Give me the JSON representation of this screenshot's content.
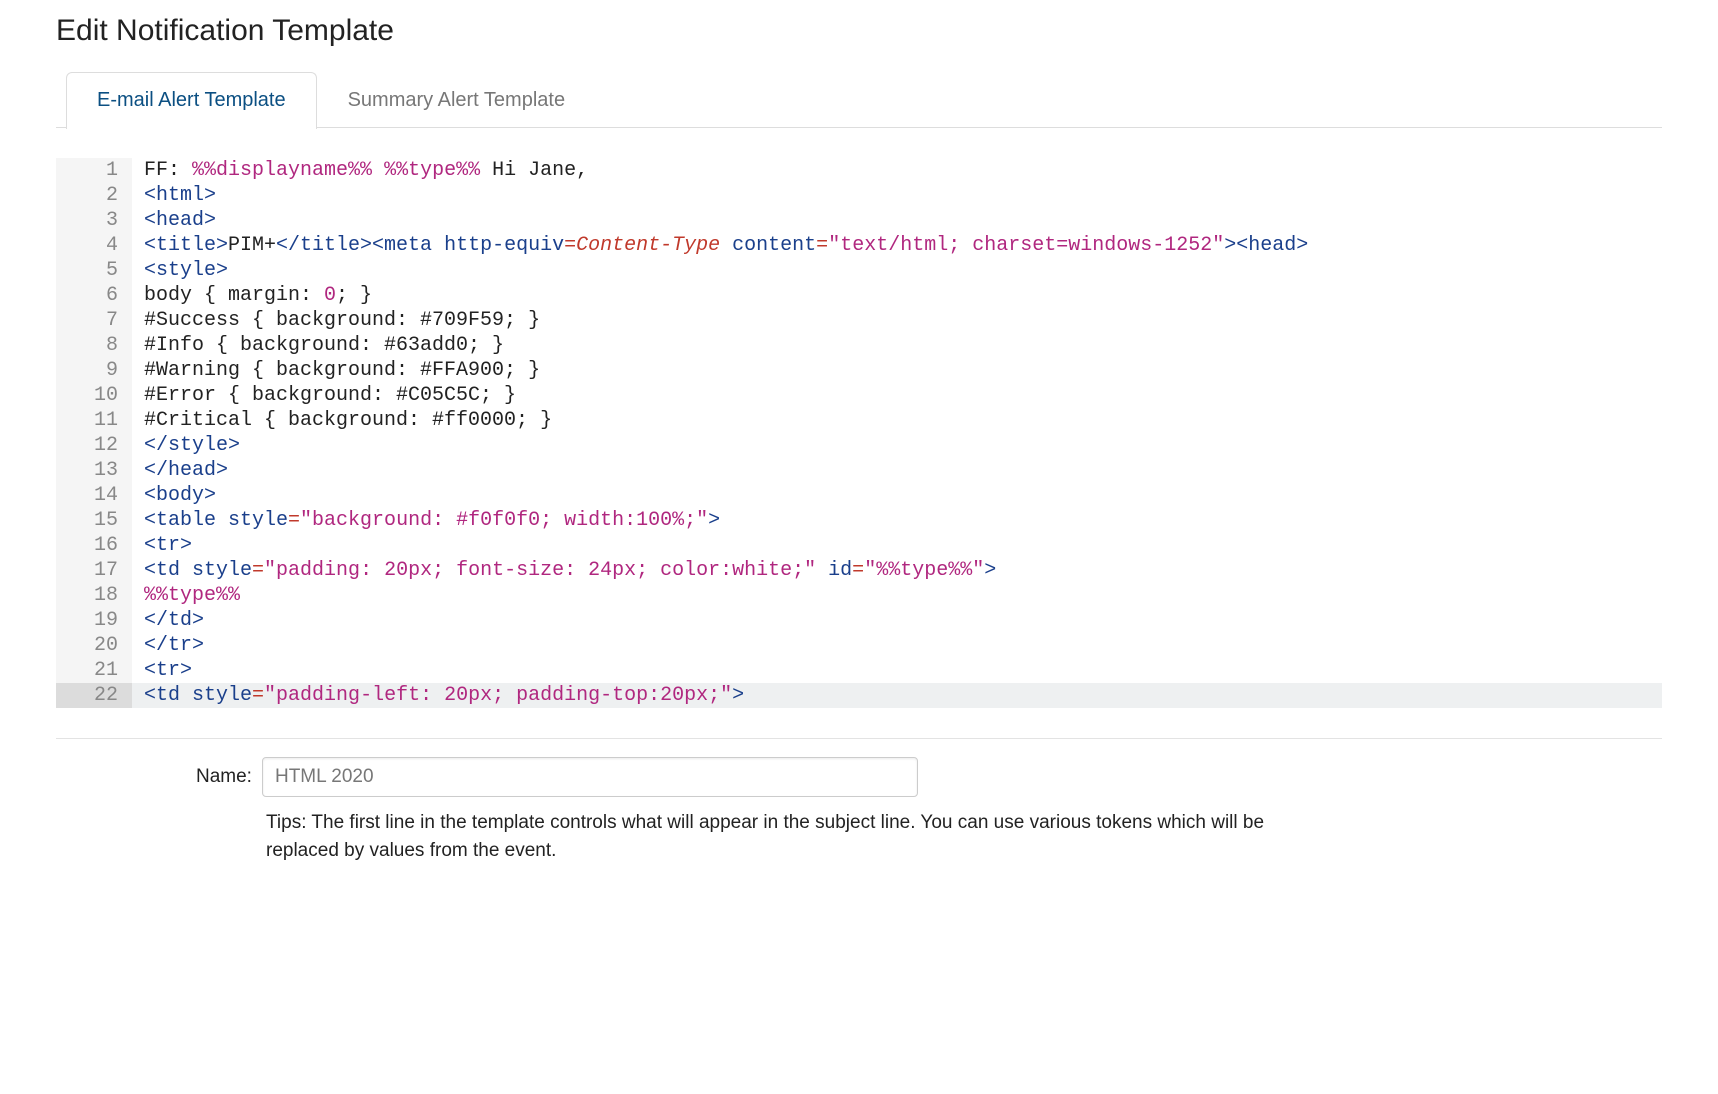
{
  "header": {
    "title": "Edit Notification Template"
  },
  "tabs": [
    {
      "label": "E-mail Alert Template",
      "active": true
    },
    {
      "label": "Summary Alert Template",
      "active": false
    }
  ],
  "editor": {
    "current_line": 22,
    "lines": [
      {
        "n": 1,
        "segments": [
          {
            "t": "FF: ",
            "c": "c-default"
          },
          {
            "t": "%%displayname%%",
            "c": "c-token"
          },
          {
            "t": " ",
            "c": "c-default"
          },
          {
            "t": "%%type%%",
            "c": "c-token"
          },
          {
            "t": " Hi Jane,",
            "c": "c-default"
          }
        ]
      },
      {
        "n": 2,
        "segments": [
          {
            "t": "<html>",
            "c": "c-tag"
          }
        ]
      },
      {
        "n": 3,
        "segments": [
          {
            "t": "<head>",
            "c": "c-tag"
          }
        ]
      },
      {
        "n": 4,
        "segments": [
          {
            "t": "<title>",
            "c": "c-tag"
          },
          {
            "t": "PIM+",
            "c": "c-default"
          },
          {
            "t": "</title>",
            "c": "c-tag"
          },
          {
            "t": "<meta ",
            "c": "c-tag"
          },
          {
            "t": "http-equiv",
            "c": "c-attr"
          },
          {
            "t": "=",
            "c": "c-equals"
          },
          {
            "t": "Content-Type",
            "c": "c-value"
          },
          {
            "t": " ",
            "c": "c-default"
          },
          {
            "t": "content",
            "c": "c-attr"
          },
          {
            "t": "=",
            "c": "c-equals"
          },
          {
            "t": "\"text/html; charset=windows-1252\"",
            "c": "c-string"
          },
          {
            "t": ">",
            "c": "c-tag"
          },
          {
            "t": "<head>",
            "c": "c-tag"
          }
        ]
      },
      {
        "n": 5,
        "segments": [
          {
            "t": "<style>",
            "c": "c-tag"
          }
        ]
      },
      {
        "n": 6,
        "segments": [
          {
            "t": "body { margin: ",
            "c": "c-default"
          },
          {
            "t": "0",
            "c": "c-num"
          },
          {
            "t": "; }",
            "c": "c-default"
          }
        ]
      },
      {
        "n": 7,
        "segments": [
          {
            "t": "#Success { background: #709F59; }",
            "c": "c-default"
          }
        ]
      },
      {
        "n": 8,
        "segments": [
          {
            "t": "#Info { background: #63add0; }",
            "c": "c-default"
          }
        ]
      },
      {
        "n": 9,
        "segments": [
          {
            "t": "#Warning { background: #FFA900; }",
            "c": "c-default"
          }
        ]
      },
      {
        "n": 10,
        "segments": [
          {
            "t": "#Error { background: #C05C5C; }",
            "c": "c-default"
          }
        ]
      },
      {
        "n": 11,
        "segments": [
          {
            "t": "#Critical { background: #ff0000; }",
            "c": "c-default"
          }
        ]
      },
      {
        "n": 12,
        "segments": [
          {
            "t": "</style>",
            "c": "c-tag"
          }
        ]
      },
      {
        "n": 13,
        "segments": [
          {
            "t": "</head>",
            "c": "c-tag"
          }
        ]
      },
      {
        "n": 14,
        "segments": [
          {
            "t": "<body>",
            "c": "c-tag"
          }
        ]
      },
      {
        "n": 15,
        "segments": [
          {
            "t": "<table ",
            "c": "c-tag"
          },
          {
            "t": "style",
            "c": "c-attr"
          },
          {
            "t": "=",
            "c": "c-equals"
          },
          {
            "t": "\"background: #f0f0f0; width:100%;\"",
            "c": "c-string"
          },
          {
            "t": ">",
            "c": "c-tag"
          }
        ]
      },
      {
        "n": 16,
        "segments": [
          {
            "t": "<tr>",
            "c": "c-tag"
          }
        ]
      },
      {
        "n": 17,
        "segments": [
          {
            "t": "<td ",
            "c": "c-tag"
          },
          {
            "t": "style",
            "c": "c-attr"
          },
          {
            "t": "=",
            "c": "c-equals"
          },
          {
            "t": "\"padding: 20px; font-size: 24px; color:white;\"",
            "c": "c-string"
          },
          {
            "t": " ",
            "c": "c-default"
          },
          {
            "t": "id",
            "c": "c-attr"
          },
          {
            "t": "=",
            "c": "c-equals"
          },
          {
            "t": "\"%%type%%\"",
            "c": "c-string"
          },
          {
            "t": ">",
            "c": "c-tag"
          }
        ]
      },
      {
        "n": 18,
        "segments": [
          {
            "t": "%%type%%",
            "c": "c-token"
          }
        ]
      },
      {
        "n": 19,
        "segments": [
          {
            "t": "</td>",
            "c": "c-tag"
          }
        ]
      },
      {
        "n": 20,
        "segments": [
          {
            "t": "</tr>",
            "c": "c-tag"
          }
        ]
      },
      {
        "n": 21,
        "segments": [
          {
            "t": "<tr>",
            "c": "c-tag"
          }
        ]
      },
      {
        "n": 22,
        "segments": [
          {
            "t": "<td ",
            "c": "c-tag"
          },
          {
            "t": "style",
            "c": "c-attr"
          },
          {
            "t": "=",
            "c": "c-equals"
          },
          {
            "t": "\"padding-left: 20px; padding-top:20px;\"",
            "c": "c-string"
          },
          {
            "t": ">",
            "c": "c-tag"
          }
        ]
      }
    ]
  },
  "form": {
    "name_label": "Name:",
    "name_value": "HTML 2020",
    "tips": "Tips: The first line in the template controls what will appear in the subject line. You can use various tokens which will be replaced by values from the event."
  }
}
